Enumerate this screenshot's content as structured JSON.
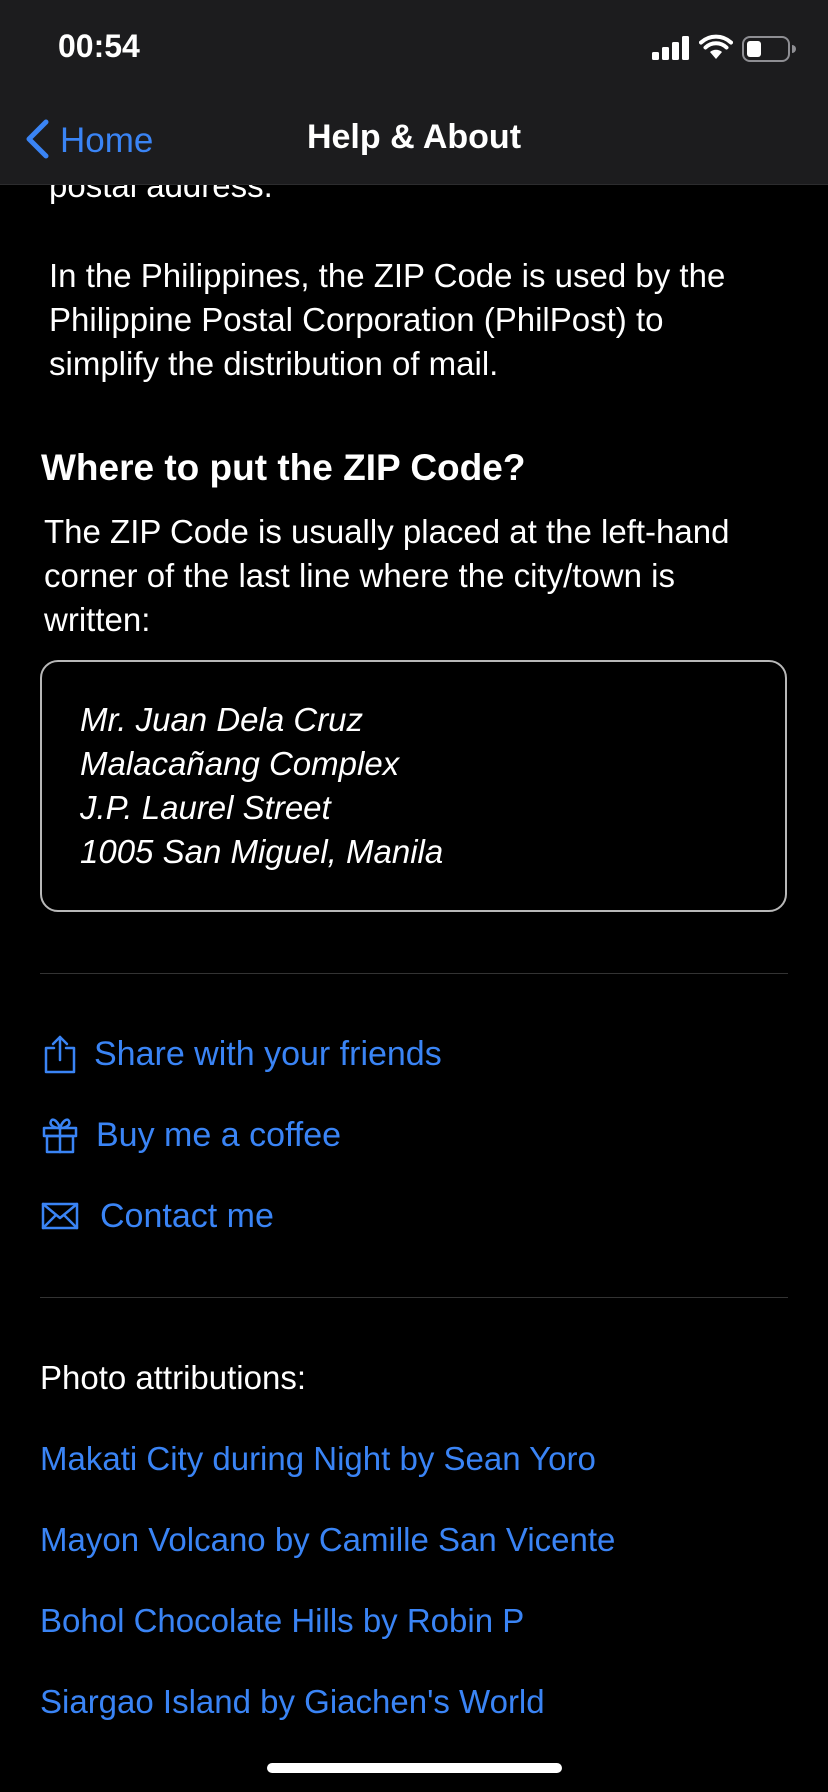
{
  "status_bar": {
    "time": "00:54"
  },
  "nav": {
    "back_label": "Home",
    "title": "Help & About"
  },
  "content": {
    "partial_line": "postal address.",
    "philippines_paragraph": [
      "In the Philippines, the ZIP Code is used by the",
      "Philippine Postal Corporation (PhilPost) to",
      "simplify the distribution of mail."
    ],
    "heading": "Where to put the ZIP Code?",
    "placement_paragraph": [
      "The ZIP Code is usually placed at the left-hand",
      "corner of the last line where the city/town is",
      "written:"
    ],
    "address_example": [
      "Mr. Juan Dela Cruz",
      "Malacañang Complex",
      "J.P. Laurel Street",
      "1005 San Miguel, Manila"
    ]
  },
  "actions": [
    {
      "label": "Share with your friends",
      "icon": "share-icon"
    },
    {
      "label": "Buy me a coffee",
      "icon": "gift-icon"
    },
    {
      "label": "Contact me",
      "icon": "envelope-icon"
    }
  ],
  "attributions": {
    "label": "Photo attributions:",
    "links": [
      "Makati City during Night by Sean Yoro",
      "Mayon Volcano by Camille San Vicente",
      "Bohol Chocolate Hills by Robin P",
      "Siargao Island by Giachen's World"
    ]
  },
  "colors": {
    "accent": "#3a84f5",
    "background": "#000000",
    "bar": "#1c1c1e"
  }
}
